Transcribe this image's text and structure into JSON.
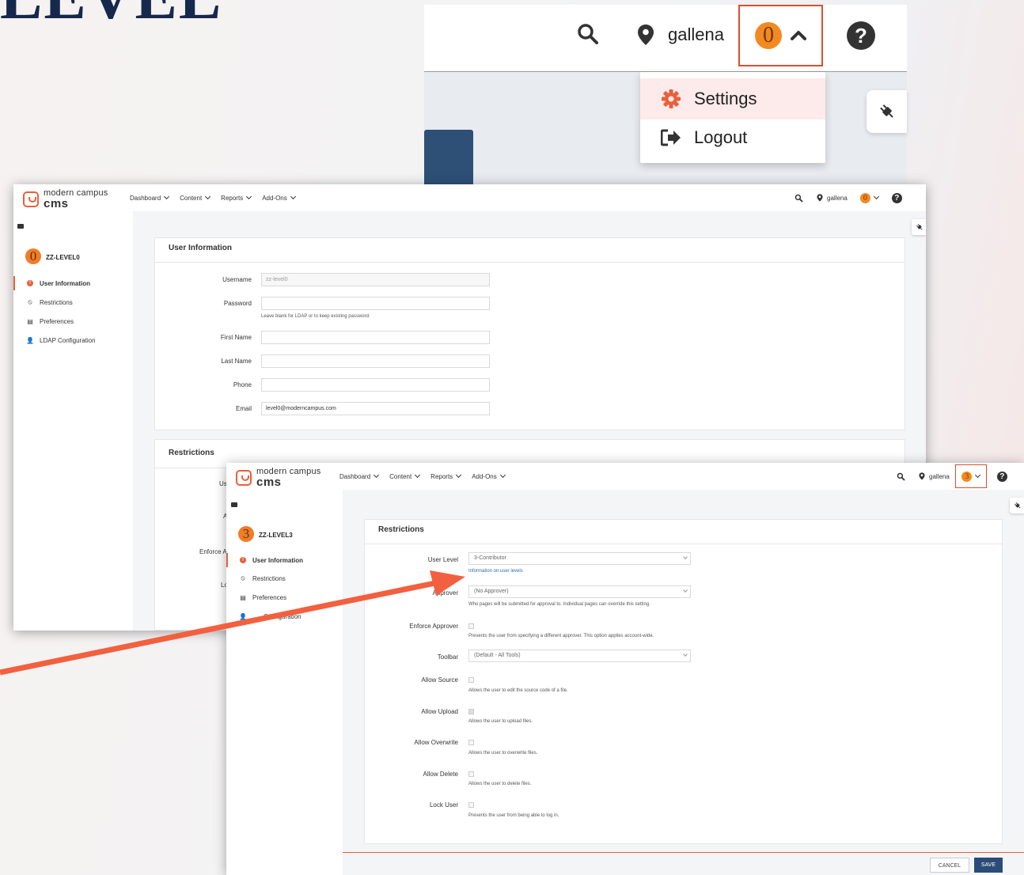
{
  "heading": "LEVEL",
  "zoom": {
    "username": "gallena",
    "badge": "0",
    "help": "?",
    "menu": [
      {
        "label": "Settings",
        "icon": "gear-icon"
      },
      {
        "label": "Logout",
        "icon": "sign-out-icon"
      }
    ]
  },
  "colors": {
    "accent": "#e8603c",
    "badge": "#f28a22",
    "navy": "#2b4c78",
    "highlight_border": "#d9502e"
  },
  "window1": {
    "logo": {
      "line1": "modern campus",
      "line2": "cms"
    },
    "nav": [
      "Dashboard",
      "Content",
      "Reports",
      "Add-Ons"
    ],
    "username": "gallena",
    "badge": "0",
    "user": {
      "badge": "0",
      "name": "ZZ-LEVEL0"
    },
    "sidebar": [
      {
        "label": "User Information",
        "icon": "info-icon"
      },
      {
        "label": "Restrictions",
        "icon": "ban-icon"
      },
      {
        "label": "Preferences",
        "icon": "toolbox-icon"
      },
      {
        "label": "LDAP Configuration",
        "icon": "user-cog-icon"
      }
    ],
    "card_title": "User Information",
    "fields": {
      "username_label": "Username",
      "username_value": "zz-level0",
      "password_label": "Password",
      "password_help": "Leave blank for LDAP or to keep existing password.",
      "first_name_label": "First Name",
      "last_name_label": "Last Name",
      "phone_label": "Phone",
      "email_label": "Email",
      "email_value": "level0@moderncampus.com"
    },
    "restrictions_title": "Restrictions",
    "peek_labels": [
      "Us",
      "A",
      "Enforce A",
      "Lo"
    ]
  },
  "window2": {
    "logo": {
      "line1": "modern campus",
      "line2": "cms"
    },
    "nav": [
      "Dashboard",
      "Content",
      "Reports",
      "Add-Ons"
    ],
    "username": "gallena",
    "badge": "3",
    "user": {
      "badge": "3",
      "name": "ZZ-LEVEL3"
    },
    "sidebar": [
      {
        "label": "User Information",
        "icon": "info-icon"
      },
      {
        "label": "Restrictions",
        "icon": "ban-icon"
      },
      {
        "label": "Preferences",
        "icon": "toolbox-icon"
      },
      {
        "label": "Configuration",
        "icon": "user-cog-icon"
      }
    ],
    "card_title": "Restrictions",
    "user_level": {
      "label": "User Level",
      "value": "3-Contributor",
      "link": "Information on user levels"
    },
    "approver": {
      "label": "Approver",
      "value": "(No Approver)",
      "help": "Who pages will be submitted for approval to. Individual pages can override this setting."
    },
    "enforce_approver": {
      "label": "Enforce Approver",
      "help": "Prevents the user from specifying a different approver. This option applies account-wide."
    },
    "toolbar": {
      "label": "Toolbar",
      "value": "(Default - All Tools)"
    },
    "allow_source": {
      "label": "Allow Source",
      "help": "Allows the user to edit the source code of a file."
    },
    "allow_upload": {
      "label": "Allow Upload",
      "help": "Allows the user to upload files."
    },
    "allow_overwrite": {
      "label": "Allow Overwrite",
      "help": "Allows the user to overwrite files."
    },
    "allow_delete": {
      "label": "Allow Delete",
      "help": "Allows the user to delete files."
    },
    "lock_user": {
      "label": "Lock User",
      "help": "Prevents the user from being able to log in."
    },
    "buttons": {
      "cancel": "CANCEL",
      "save": "SAVE"
    }
  }
}
